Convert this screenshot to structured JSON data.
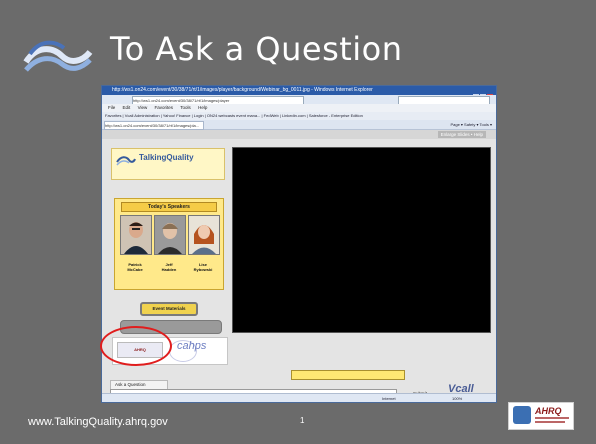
{
  "slide": {
    "title": "To Ask a Question",
    "footer_url": "www.TalkingQuality.ahrq.gov",
    "page_number": "1",
    "footer_logo_name": "AHRQ",
    "title_logo": "talkingquality-wave-icon"
  },
  "browser": {
    "window_title": "http://ws1.on24.com/event/30/38/71/rt/1/images/player/background/Webinar_bg_0011.jpg - Windows Internet Explorer",
    "address": "http://ws1.on24.com/event/30/38/71/rt/1/images/player",
    "menu": [
      "File",
      "Edit",
      "View",
      "Favorites",
      "Tools",
      "Help"
    ],
    "favorites": "Favorites  |  Vcall Administration  |  Yahoo! Finance  |  Login  |  ON24 webcasts event mana...  |  FedWeb  |  Linkedin.com  |  Salesforce - Enterprise Edition",
    "tab_title": "http://ws1.on24.com/event/30/38/71/rt/1/images/pla...",
    "toolbar_tools": "Page ▾  Safety ▾  Tools ▾",
    "status_zone": "Internet",
    "status_zoom": "100%"
  },
  "player": {
    "enlarge_label": "Enlarge Slides  •  Help",
    "brand": "TalkingQuality",
    "speakers_heading": "Today's Speakers",
    "speakers": [
      {
        "first": "Patrick",
        "last": "McCabe"
      },
      {
        "first": "Jeff",
        "last": "Hadden"
      },
      {
        "first": "Lise",
        "last": "Rybowski"
      }
    ],
    "event_materials_label": "Event Materials",
    "partner_logo_1": "AHRQ",
    "partner_logo_2": "cahps",
    "ask_tab_label": "Ask a Question",
    "submit_label": "Submit",
    "vcall_brand": "Vcall"
  },
  "colors": {
    "slide_bg": "#6b6b6b",
    "highlight": "#e01d1d",
    "speakers_panel": "#ffe98a",
    "video_bg": "#000000"
  }
}
